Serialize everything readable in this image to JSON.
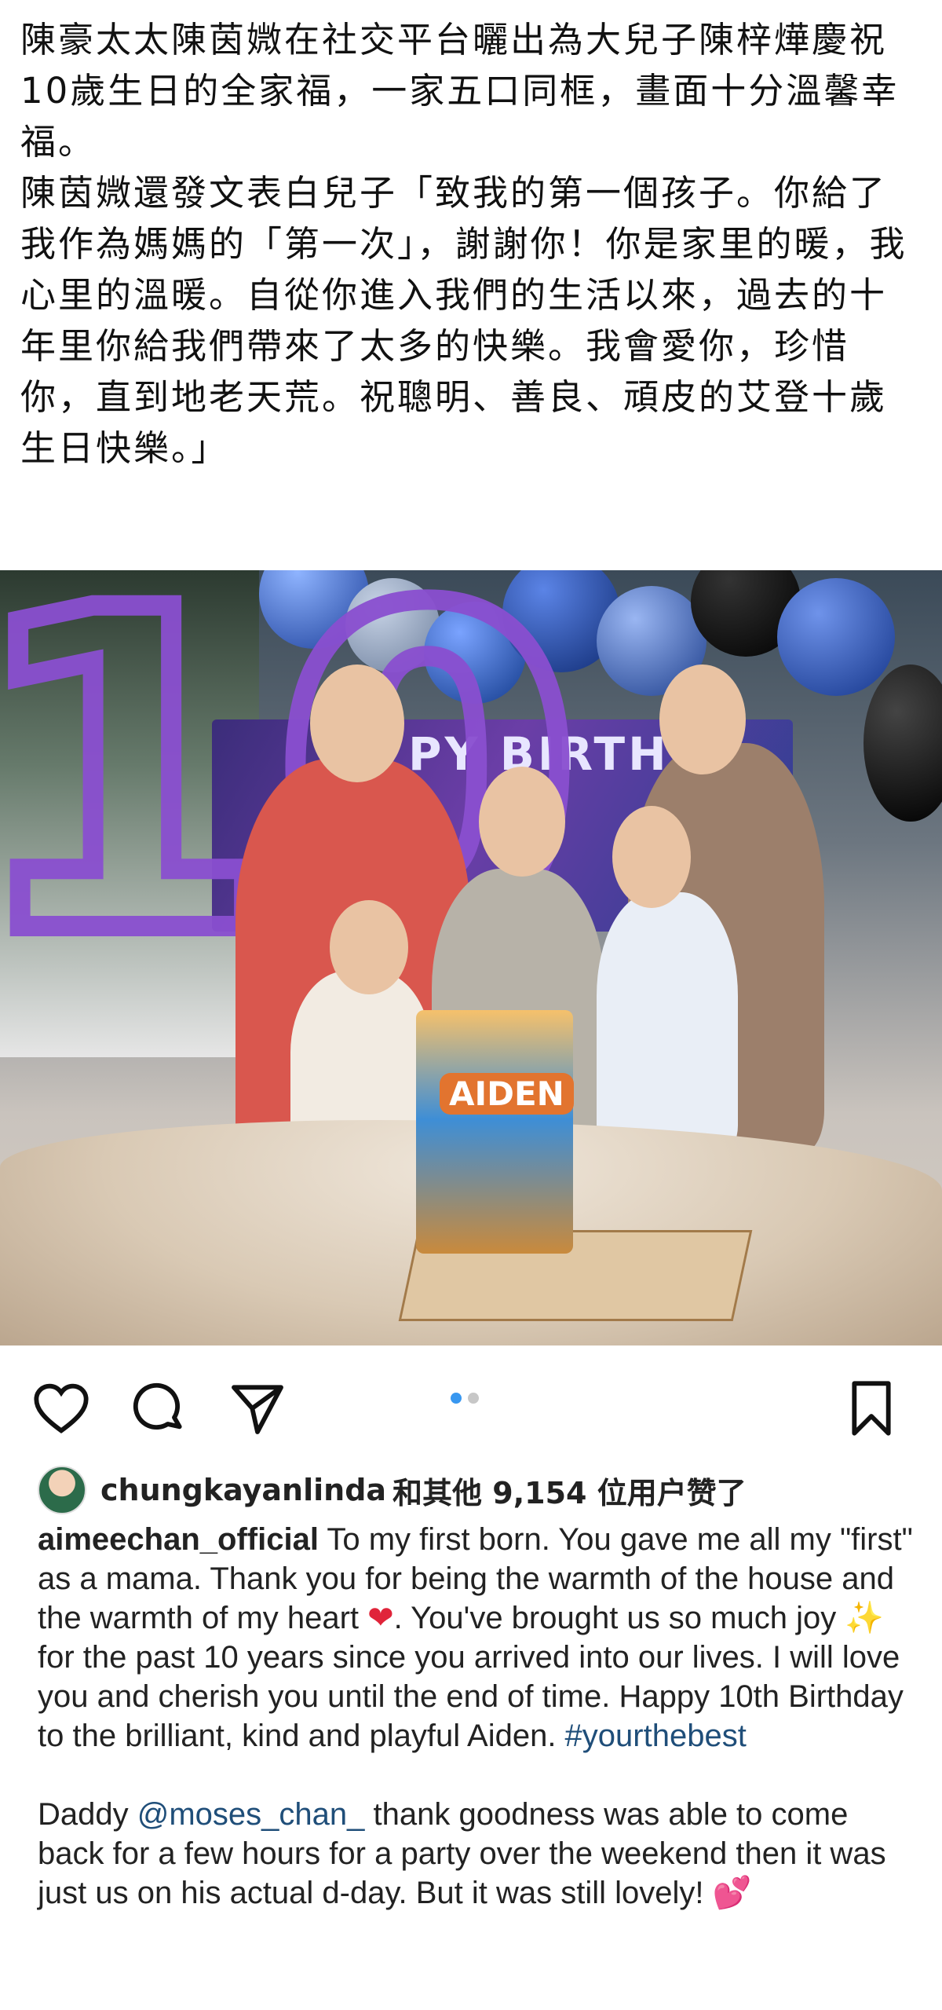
{
  "article": {
    "paragraph1": "陳豪太太陳茵媺在社交平台曬出為大兒子陳梓燁慶祝10歲生日的全家福，一家五口同框，畫面十分溫馨幸福。",
    "paragraph2": "陳茵媺還發文表白兒子「致我的第一個孩子。你給了我作為媽媽的「第一次」，謝謝你！你是家里的暖，我心里的溫暖。自從你進入我們的生活以來，過去的十年里你給我們帶來了太多的快樂。我會愛你，珍惜你，直到地老天荒。祝聰明、善良、頑皮的艾登十歲生日快樂。」"
  },
  "photo": {
    "banner_text": "PY BIRTHD",
    "number_balloon": "10",
    "cake_label": "AIDEN"
  },
  "actions": {
    "like_icon": "heart-icon",
    "comment_icon": "comment-icon",
    "share_icon": "send-icon",
    "save_icon": "bookmark-icon",
    "carousel_active_color": "#3897f0",
    "carousel_inactive_color": "#c7c7c7"
  },
  "likes": {
    "user": "chungkayanlinda",
    "rest": "和其他 9,154 位用户赞了"
  },
  "caption": {
    "username": "aimeechan_official",
    "text_part1": " To my  first born. You gave me all my \"first\" as a mama. Thank you for being the warmth of the house and the warmth of my heart ",
    "emoji_heart": "❤",
    "text_part2": ". You've brought us so much joy ",
    "emoji_sparkle": "✨",
    "text_part3": " for the past 10 years since you arrived into our lives. I will love you and cherish you until the end of time. Happy  10th Birthday to the brilliant, kind and playful Aiden. ",
    "hashtag": "#yourthebest",
    "para2_prefix": "Daddy ",
    "mention": "@moses_chan_",
    "para2_text": "  thank goodness was able to come back for a few hours for a party over the weekend then it was just us on his actual d-day. But it was still lovely! ",
    "emoji_hearts": "💕"
  }
}
